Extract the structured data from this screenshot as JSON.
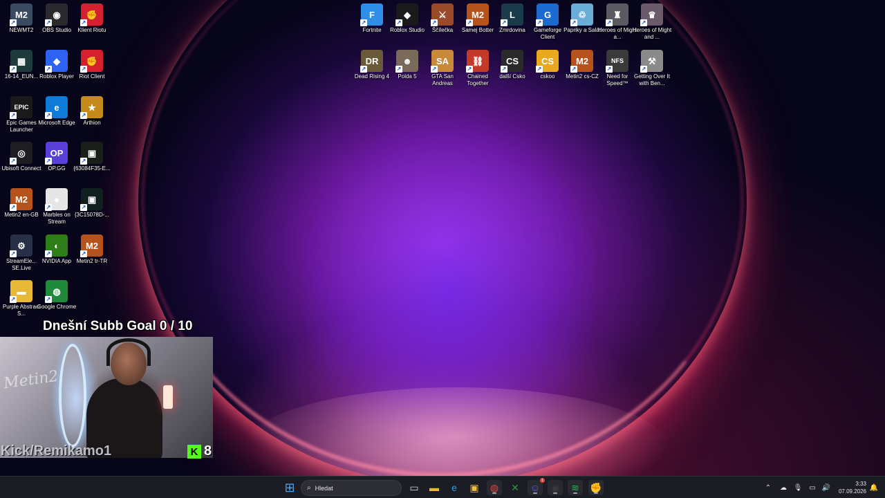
{
  "desktop": {
    "icons": [
      {
        "label": "NEWMT2",
        "icon": "newmt2-icon",
        "glyph": "M2",
        "color": "#3a4a60"
      },
      {
        "label": "OBS Studio",
        "icon": "obs-icon",
        "glyph": "◉",
        "color": "#2a2a2e"
      },
      {
        "label": "Klient Riotu",
        "icon": "riot-icon",
        "glyph": "✊",
        "color": "#d4202f"
      },
      {
        "label": "16-14_EUN...",
        "icon": "screenshot-file-icon",
        "glyph": "▦",
        "color": "#1e3a3a"
      },
      {
        "label": "Roblox Player",
        "icon": "roblox-player-icon",
        "glyph": "◆",
        "color": "#2d63f2"
      },
      {
        "label": "Riot Client",
        "icon": "riot-client-icon",
        "glyph": "✊",
        "color": "#d4202f"
      },
      {
        "label": "Epic Games Launcher",
        "icon": "epic-games-icon",
        "glyph": "EPIC",
        "color": "#1a1a1a"
      },
      {
        "label": "Microsoft Edge",
        "icon": "edge-icon",
        "glyph": "e",
        "color": "#0f7bd8"
      },
      {
        "label": "Arthion",
        "icon": "arthion-icon",
        "glyph": "★",
        "color": "#c48a1a"
      },
      {
        "label": "Ubisoft Connect",
        "icon": "ubisoft-icon",
        "glyph": "◎",
        "color": "#1d1d22"
      },
      {
        "label": "OP.GG",
        "icon": "opgg-icon",
        "glyph": "OP",
        "color": "#5a3fd8"
      },
      {
        "label": "{63084F35-E...",
        "icon": "guid-file-icon",
        "glyph": "▣",
        "color": "#1a1f1a"
      },
      {
        "label": "Metin2 en-GB",
        "icon": "metin2-en-icon",
        "glyph": "M2",
        "color": "#b6521b"
      },
      {
        "label": "Marbles on Stream",
        "icon": "marbles-icon",
        "glyph": "●",
        "color": "#e6e6e6"
      },
      {
        "label": "{3C15078D-...",
        "icon": "guid-file-icon-2",
        "glyph": "▣",
        "color": "#10201e"
      },
      {
        "label": "StreamEle... SE.Live",
        "icon": "streamelements-icon",
        "glyph": "⚙",
        "color": "#283048"
      },
      {
        "label": "NVIDIA App",
        "icon": "nvidia-icon",
        "glyph": "◐",
        "color": "#2e7d18"
      },
      {
        "label": "Metin2 tr-TR",
        "icon": "metin2-tr-icon",
        "glyph": "M2",
        "color": "#b6521b"
      },
      {
        "label": "Purple Abstract S...",
        "icon": "folder-icon",
        "glyph": "▬",
        "color": "#e8b838"
      },
      {
        "label": "Google Chrome",
        "icon": "chrome-icon",
        "glyph": "◍",
        "color": "#1f8a3b"
      },
      {
        "label": "Fortnite",
        "icon": "fortnite-icon",
        "glyph": "F",
        "color": "#2f8fe8"
      },
      {
        "label": "Roblox Studio",
        "icon": "roblox-studio-icon",
        "glyph": "◆",
        "color": "#1a1a1a"
      },
      {
        "label": "Ščílečka",
        "icon": "game-shortcut-icon",
        "glyph": "⚔",
        "color": "#9a4a28"
      },
      {
        "label": "Samej Botter",
        "icon": "metin2-botter-icon",
        "glyph": "M2",
        "color": "#b6521b"
      },
      {
        "label": "Zmrdovina",
        "icon": "league-icon",
        "glyph": "L",
        "color": "#1b3a4a"
      },
      {
        "label": "Gameforge Client",
        "icon": "gameforge-icon",
        "glyph": "G",
        "color": "#1a6ad0"
      },
      {
        "label": "Papriky a Salát",
        "icon": "recycle-bin-icon",
        "glyph": "♲",
        "color": "#6aaed8"
      },
      {
        "label": "Heroes of Might a...",
        "icon": "heroes-icon",
        "glyph": "♜",
        "color": "#5a5a60"
      },
      {
        "label": "Heroes of Might and ...",
        "icon": "heroes-icon-2",
        "glyph": "♛",
        "color": "#6a5a6a"
      },
      {
        "label": "Dead Rising 4",
        "icon": "dead-rising-icon",
        "glyph": "DR",
        "color": "#6a5a3a"
      },
      {
        "label": "Polda 5",
        "icon": "polda-icon",
        "glyph": "☻",
        "color": "#7a6a5a"
      },
      {
        "label": "GTA San Andreas",
        "icon": "gta-icon",
        "glyph": "SA",
        "color": "#c88a3a"
      },
      {
        "label": "Chained Together",
        "icon": "chained-together-icon",
        "glyph": "⛓",
        "color": "#c43a2a"
      },
      {
        "label": "další Csko",
        "icon": "csgo-icon",
        "glyph": "CS",
        "color": "#2a2a2a"
      },
      {
        "label": "cskoo",
        "icon": "cs-icon",
        "glyph": "CS",
        "color": "#e8a820"
      },
      {
        "label": "Metin2 cs-CZ",
        "icon": "metin2-cz-icon",
        "glyph": "M2",
        "color": "#b6521b"
      },
      {
        "label": "Need for Speed™",
        "icon": "nfs-icon",
        "glyph": "NFS",
        "color": "#3a3a3a"
      },
      {
        "label": "Getting Over It with Ben...",
        "icon": "getting-over-it-icon",
        "glyph": "⚒",
        "color": "#8a8a8a"
      }
    ]
  },
  "overlay": {
    "subb_goal": "Dnešní Subb Goal 0 / 10",
    "kick_channel": "Kick/Remikamo1",
    "kick_logo": "K",
    "viewer_count": "8",
    "sign_text": "Metin2"
  },
  "taskbar": {
    "search_placeholder": "Hledat",
    "apps": [
      {
        "name": "start-button",
        "icon": "windows-logo-icon",
        "glyph": "⊞",
        "color": "#4aa3f0",
        "running": false
      },
      {
        "name": "task-view-button",
        "icon": "task-view-icon",
        "glyph": "▭",
        "color": "#cfd3da",
        "running": false
      },
      {
        "name": "file-explorer-button",
        "icon": "folder-icon",
        "glyph": "▬",
        "color": "#e8b838",
        "running": false
      },
      {
        "name": "edge-button",
        "icon": "edge-icon",
        "glyph": "e",
        "color": "#2aa0e8",
        "running": false
      },
      {
        "name": "store-button",
        "icon": "store-icon",
        "glyph": "▣",
        "color": "#f0c040",
        "running": false
      },
      {
        "name": "chrome-button",
        "icon": "chrome-icon",
        "glyph": "◍",
        "color": "#e8433a",
        "running": true
      },
      {
        "name": "xbox-button",
        "icon": "xbox-icon",
        "glyph": "✕",
        "color": "#2c9a3c",
        "running": false
      },
      {
        "name": "discord-button",
        "icon": "discord-icon",
        "glyph": "☺",
        "color": "#5865f2",
        "running": true,
        "badge": "1"
      },
      {
        "name": "obs-button",
        "icon": "obs-icon",
        "glyph": "◉",
        "color": "#3a3a3e",
        "running": true
      },
      {
        "name": "spotify-button",
        "icon": "spotify-icon",
        "glyph": "≋",
        "color": "#1db954",
        "running": true
      },
      {
        "name": "riot-button",
        "icon": "riot-icon",
        "glyph": "✊",
        "color": "#d4202f",
        "running": true
      }
    ],
    "tray": [
      {
        "name": "tray-overflow-chevron",
        "icon": "chevron-up-icon",
        "glyph": "⌃"
      },
      {
        "name": "tray-onedrive",
        "icon": "cloud-icon",
        "glyph": "☁"
      },
      {
        "name": "tray-microphone",
        "icon": "microphone-icon",
        "glyph": "🎙"
      },
      {
        "name": "tray-network",
        "icon": "network-icon",
        "glyph": "▭"
      },
      {
        "name": "tray-volume",
        "icon": "speaker-icon",
        "glyph": "🔊"
      }
    ],
    "clock_time": "3:33",
    "clock_date": "07.09.2026",
    "notification_icon": "notification-bell-icon"
  }
}
